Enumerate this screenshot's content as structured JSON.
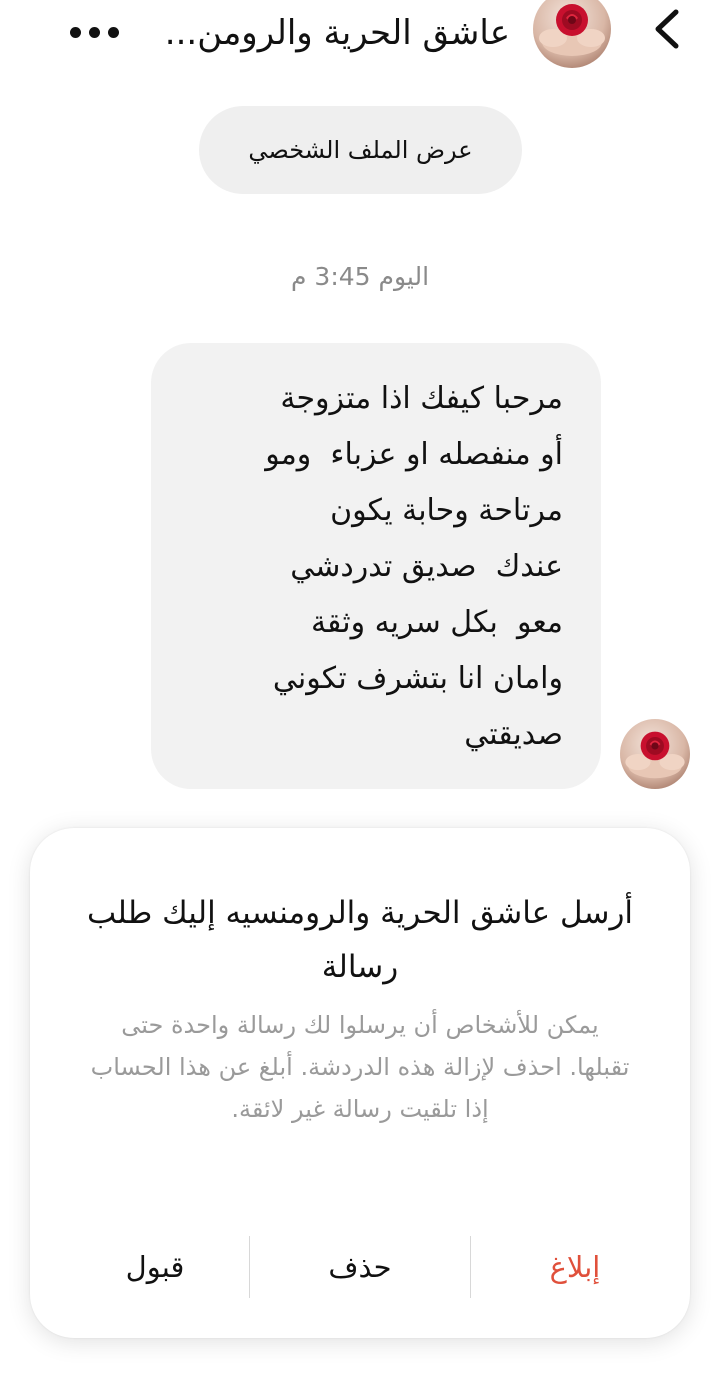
{
  "header": {
    "title": "عاشق الحرية والرومن...",
    "back_icon": "chevron-left-icon",
    "more_icon": "more-horizontal-icon",
    "avatar_icon": "avatar-rose-hands"
  },
  "profile_button": {
    "label": "عرض الملف الشخصي"
  },
  "timestamp": "اليوم 3:45 م",
  "message": {
    "text": "مرحبا كيفك اذا متزوجة\nأو منفصله او عزباء  ومو\nمرتاحة وحابة يكون\nعندك  صديق تدردشي\nمعو  بكل سريه وثقة\nوامان انا بتشرف تكوني\nصديقتي"
  },
  "request_card": {
    "title": "أرسل عاشق الحرية والرومنسيه إليك طلب رسالة",
    "body": "يمكن للأشخاص أن يرسلوا لك رسالة واحدة حتى تقبلها. احذف لإزالة هذه الدردشة. أبلغ عن هذا الحساب إذا تلقيت رسالة غير لائقة.",
    "actions": {
      "report": "إبلاغ",
      "delete": "حذف",
      "accept": "قبول"
    }
  },
  "colors": {
    "report": "#e0503b",
    "bubble_bg": "#f2f2f2",
    "secondary_text": "#9a9a9a",
    "rose": "#c8102e"
  }
}
